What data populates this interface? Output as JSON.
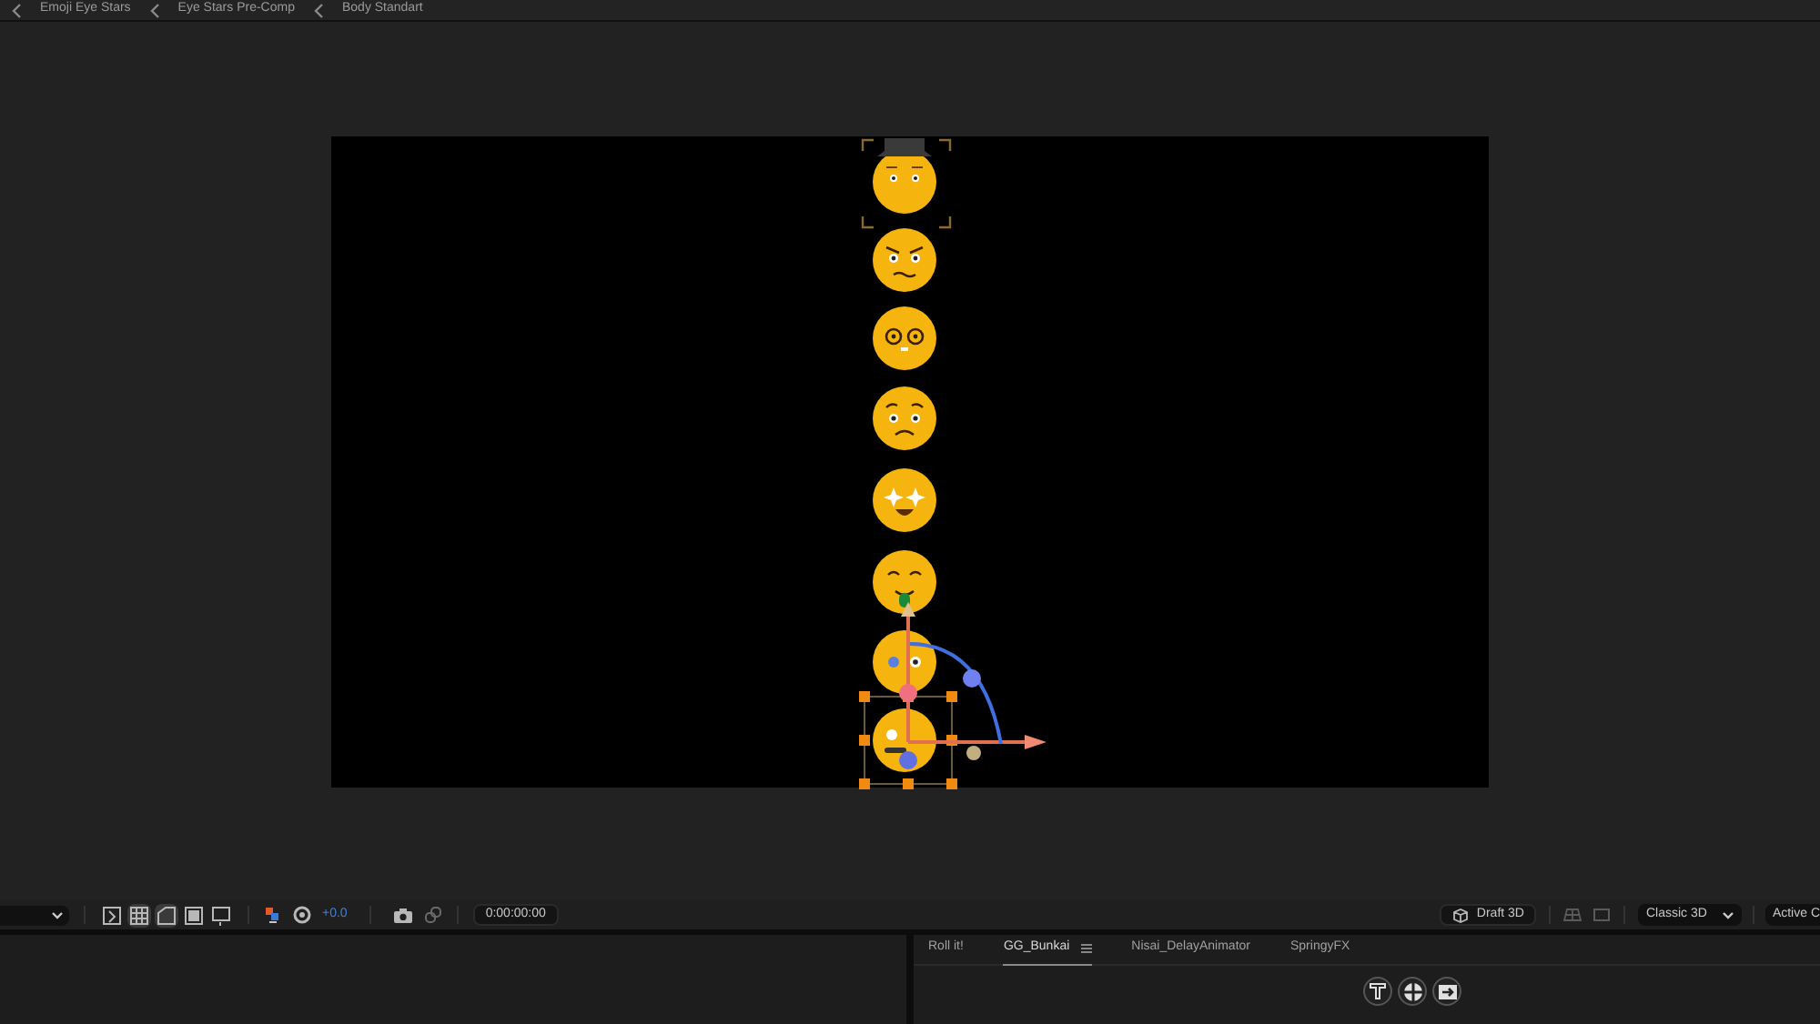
{
  "breadcrumbs": [
    {
      "label": "Emoji Eye Stars"
    },
    {
      "label": "Eye Stars Pre-Comp"
    },
    {
      "label": "Body Standart"
    }
  ],
  "toolbar": {
    "exposure": "+0.0",
    "timecode": "0:00:00:00",
    "draft_3d": "Draft 3D",
    "renderer": "Classic 3D",
    "view": "Active C"
  },
  "panel_tabs": [
    {
      "label": "Roll it!",
      "selected": false
    },
    {
      "label": "GG_Bunkai",
      "selected": true
    },
    {
      "label": "Nisai_DelayAnimator",
      "selected": false
    },
    {
      "label": "SpringyFX",
      "selected": false
    }
  ]
}
